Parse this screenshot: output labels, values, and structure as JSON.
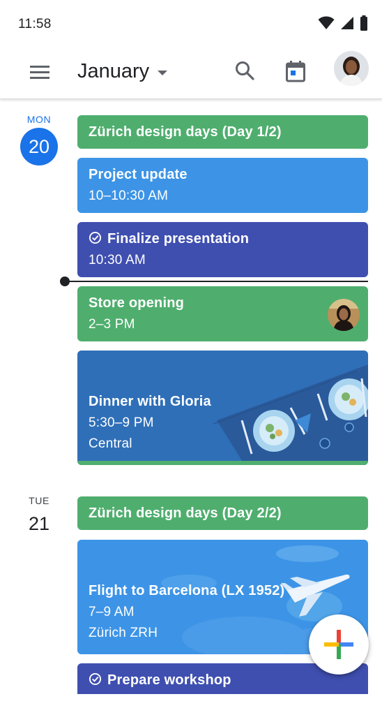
{
  "status_bar": {
    "time": "11:58",
    "icons": [
      "wifi-icon",
      "cell-signal-icon",
      "battery-icon"
    ]
  },
  "app_bar": {
    "menu_icon": "hamburger-menu-icon",
    "month": "January",
    "search_icon": "search-icon",
    "today_icon": "calendar-today-icon",
    "avatar": "profile-avatar"
  },
  "days": [
    {
      "dow": "MON",
      "day": "20",
      "is_today": true,
      "events": [
        {
          "title": "Zürich design days (Day 1/2)",
          "color": "#4fae6e"
        },
        {
          "title": "Project update",
          "time": "10–10:30 AM",
          "color": "#3d94e6"
        },
        {
          "title": "Finalize presentation",
          "time": "10:30 AM",
          "is_task": true,
          "color": "#3f4fb0"
        },
        {
          "title": "Store opening",
          "time": "2–3 PM",
          "color": "#4fae6e",
          "attendee_icon": "attendee-avatar"
        },
        {
          "title": "Dinner with Gloria",
          "time": "5:30–9 PM",
          "location": "Central",
          "color": "#2f6fb8",
          "illustration": "dinner-table-illustration"
        }
      ]
    },
    {
      "dow": "TUE",
      "day": "21",
      "is_today": false,
      "events": [
        {
          "title": "Zürich design days (Day 2/2)",
          "color": "#4fae6e"
        },
        {
          "title": "Flight to Barcelona (LX 1952)",
          "time": "7–9 AM",
          "location": "Zürich ZRH",
          "color": "#3d94e6",
          "illustration": "airplane-clouds-illustration"
        },
        {
          "title": "Prepare workshop",
          "is_task": true,
          "color": "#3f4fb0"
        }
      ]
    }
  ],
  "fab": {
    "icon": "create-plus-icon"
  },
  "colors": {
    "accent": "#1a73e8",
    "event_green": "#4fae6e",
    "event_blue": "#3d94e6",
    "event_indigo": "#3f4fb0",
    "now_line": "#202124"
  }
}
